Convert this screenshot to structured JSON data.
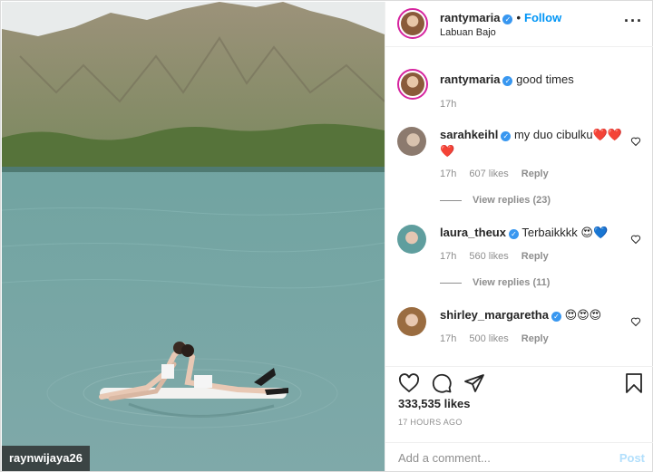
{
  "photo": {
    "watermark": "raynwijaya26",
    "colors": {
      "sky": "#e9ecec",
      "mountain": "#8f8a72",
      "trees": "#5f7a3a",
      "water": "#6e9c9a"
    }
  },
  "post": {
    "author": "rantymaria",
    "verified_icon": "verified-badge-icon",
    "follow_label": "Follow",
    "location": "Labuan Bajo",
    "caption": "good times",
    "caption_time": "17h"
  },
  "comments": [
    {
      "user": "sarahkeihl",
      "verified": true,
      "text": "my duo cibulku❤️❤️❤️",
      "time": "17h",
      "likes": "607 likes",
      "reply_label": "Reply",
      "view_replies": "View replies (23)"
    },
    {
      "user": "laura_theux",
      "verified": true,
      "text": "Terbaikkkk 😍💙",
      "time": "17h",
      "likes": "560 likes",
      "reply_label": "Reply",
      "view_replies": "View replies (11)"
    },
    {
      "user": "shirley_margaretha",
      "verified": true,
      "text": "😍😍😍",
      "time": "17h",
      "likes": "500 likes",
      "reply_label": "Reply"
    }
  ],
  "stats": {
    "likes": "333,535 likes",
    "ago": "17 HOURS AGO"
  },
  "comment_box": {
    "placeholder": "Add a comment...",
    "post_label": "Post"
  },
  "colors": {
    "accent": "#0095f6",
    "verified": "#3897f0",
    "muted": "#8e8e8e",
    "post_disabled": "#b2dffc"
  }
}
